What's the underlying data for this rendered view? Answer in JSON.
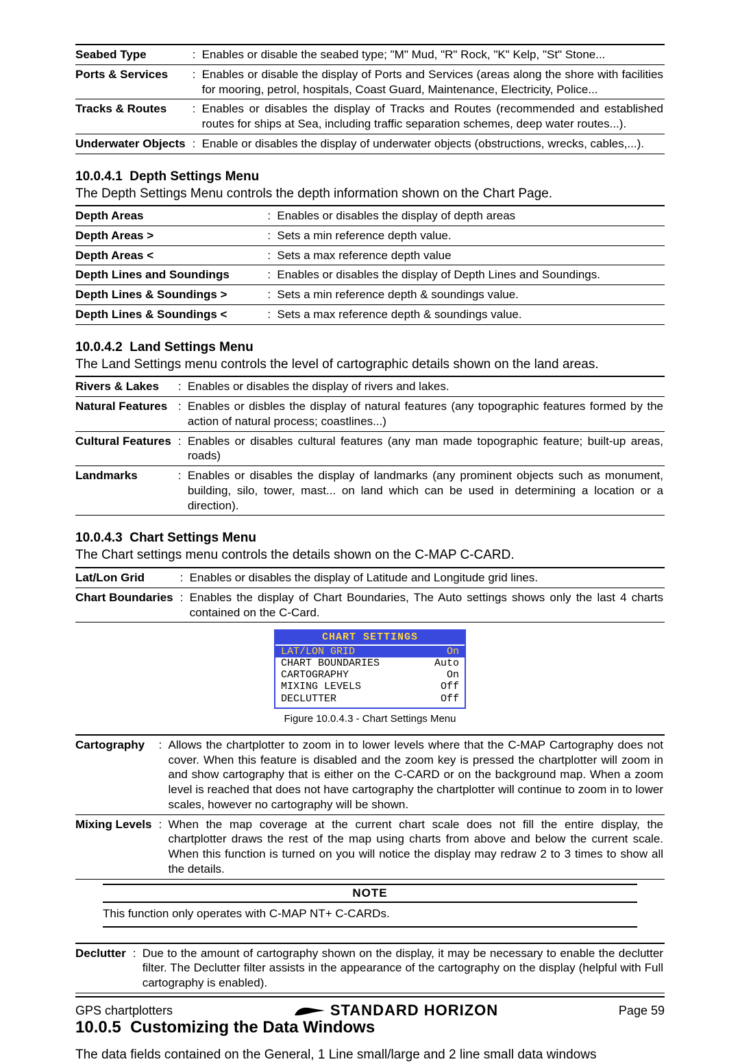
{
  "tables": {
    "top": [
      {
        "term": "Seabed Type",
        "desc": "Enables or disable the seabed type; \"M\" Mud, \"R\" Rock, \"K\" Kelp, \"St\" Stone..."
      },
      {
        "term": "Ports & Services",
        "desc": "Enables or disable the display of Ports and Services (areas along the shore with facilities for mooring, petrol, hospitals, Coast Guard, Maintenance, Electricity, Police..."
      },
      {
        "term": "Tracks & Routes",
        "desc": "Enables or disables the display of Tracks and Routes (recommended and established routes for ships at Sea, including traffic separation schemes, deep water routes...)."
      },
      {
        "term": "Underwater Objects",
        "desc": "Enable or disables the display of underwater objects (obstructions, wrecks, cables,...)."
      }
    ],
    "depth": [
      {
        "term": "Depth Areas",
        "desc": "Enables or disables the display of depth areas"
      },
      {
        "term": "Depth Areas >",
        "desc": "Sets a min reference depth value."
      },
      {
        "term": "Depth Areas <",
        "desc": "Sets a max reference depth value"
      },
      {
        "term": "Depth Lines and Soundings",
        "desc": "Enables or disables the display of Depth Lines and Soundings."
      },
      {
        "term": "Depth Lines & Soundings >",
        "desc": "Sets a min reference depth & soundings value."
      },
      {
        "term": "Depth Lines & Soundings <",
        "desc": "Sets a max reference depth & soundings value."
      }
    ],
    "land": [
      {
        "term": "Rivers & Lakes",
        "desc": "Enables or disables the display of rivers and lakes."
      },
      {
        "term": "Natural Features",
        "desc": "Enables or disbles the display of natural features (any topographic features formed by the action of natural process; coastlines...)"
      },
      {
        "term": "Cultural Features",
        "desc": "Enables or disables cultural features (any man made topographic feature; built-up areas, roads)"
      },
      {
        "term": "Landmarks",
        "desc": "Enables or disables the display of landmarks (any prominent objects such as monument, building, silo, tower, mast... on land which can be used in determining a location or a direction)."
      }
    ],
    "chart1": [
      {
        "term": "Lat/Lon Grid",
        "desc": "Enables or disables the display of Latitude and Longitude grid lines."
      },
      {
        "term": "Chart Boundaries",
        "desc": "Enables the display of Chart Boundaries, The Auto settings shows only the last 4 charts contained on the C-Card."
      }
    ],
    "chart2": [
      {
        "term": "Cartography",
        "desc": "Allows the chartplotter to zoom in to lower levels where that the C-MAP Cartography does not cover. When this feature is disabled and the zoom key is pressed the chartplotter will zoom in and show cartography that is either on the C-CARD or on the background map. When a zoom level is reached that does not have cartography the chartplotter will continue to zoom in to lower scales, however no cartography will be shown."
      },
      {
        "term": "Mixing Levels",
        "desc": "When the map coverage at the current chart scale does not fill the entire display, the chartplotter draws the rest of the map using charts from above and below the current scale. When this function is turned on you will notice the display may redraw 2 to 3 times to show all the details."
      }
    ],
    "chart3": [
      {
        "term": "Declutter",
        "desc": "Due to the amount of cartography shown on the display, it may be necessary to enable the declutter filter. The Declutter filter assists in the appearance of the cartography on the display (helpful with Full cartography is enabled)."
      }
    ]
  },
  "sections": {
    "s1": {
      "num": "10.0.4.1",
      "title": "Depth Settings Menu",
      "intro": "The Depth Settings Menu controls the depth information shown on the Chart Page."
    },
    "s2": {
      "num": "10.0.4.2",
      "title": "Land Settings Menu",
      "intro": "The Land Settings menu controls the level of cartographic details shown on the land areas."
    },
    "s3": {
      "num": "10.0.4.3",
      "title": "Chart Settings Menu",
      "intro": "The Chart settings menu controls the details shown on the C-MAP C-CARD."
    },
    "s4": {
      "num": "10.0.5",
      "title": "Customizing the Data Windows",
      "intro": "The data fields contained on the General, 1 Line small/large and 2 line small data windows"
    }
  },
  "chart_menu": {
    "title": "CHART SETTINGS",
    "rows": [
      {
        "label": "LAT/LON GRID",
        "value": "On",
        "selected": true
      },
      {
        "label": "CHART BOUNDARIES",
        "value": "Auto",
        "selected": false
      },
      {
        "label": "CARTOGRAPHY",
        "value": "On",
        "selected": false
      },
      {
        "label": "MIXING LEVELS",
        "value": "Off",
        "selected": false
      },
      {
        "label": "DECLUTTER",
        "value": "Off",
        "selected": false
      }
    ]
  },
  "fig_caption": "Figure 10.0.4.3 - Chart Settings Menu",
  "note": {
    "title": "NOTE",
    "body": "This function only operates with C-MAP NT+ C-CARDs."
  },
  "footer": {
    "left": "GPS chartplotters",
    "brand": "STANDARD HORIZON",
    "right": "Page 59"
  }
}
